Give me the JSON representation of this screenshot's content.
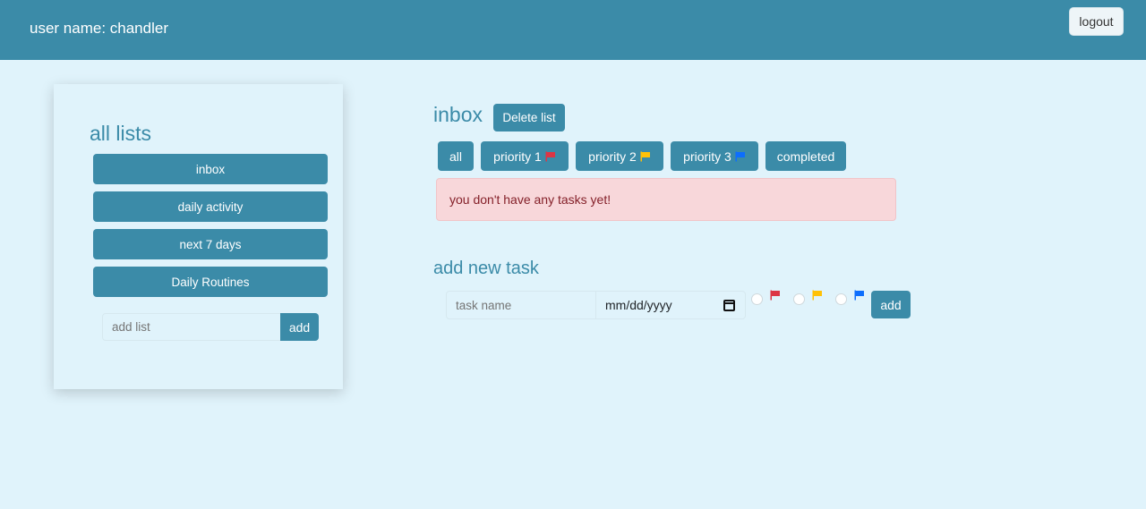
{
  "header": {
    "username": "user name: chandler",
    "logout_label": "logout"
  },
  "sidebar": {
    "title": "all lists",
    "lists": [
      {
        "label": "inbox"
      },
      {
        "label": "daily activity"
      },
      {
        "label": "next 7 days"
      },
      {
        "label": "Daily Routines"
      }
    ],
    "add_list_placeholder": "add list",
    "add_label": "add"
  },
  "main": {
    "list_title": "inbox",
    "delete_label": "Delete list",
    "filters": [
      {
        "label": "all",
        "flag_color": ""
      },
      {
        "label": "priority 1",
        "flag_color": "#dc3545"
      },
      {
        "label": "priority 2",
        "flag_color": "#ffc107"
      },
      {
        "label": "priority 3",
        "flag_color": "#0d6efd"
      },
      {
        "label": "completed",
        "flag_color": ""
      }
    ],
    "empty_message": "you don't have any tasks yet!",
    "add_task": {
      "title": "add new task",
      "task_name_placeholder": "task name",
      "date_placeholder": "mm/dd/yyyy",
      "priorities": [
        {
          "flag_color": "#dc3545"
        },
        {
          "flag_color": "#ffc107"
        },
        {
          "flag_color": "#0d6efd"
        }
      ],
      "add_label": "add"
    }
  }
}
